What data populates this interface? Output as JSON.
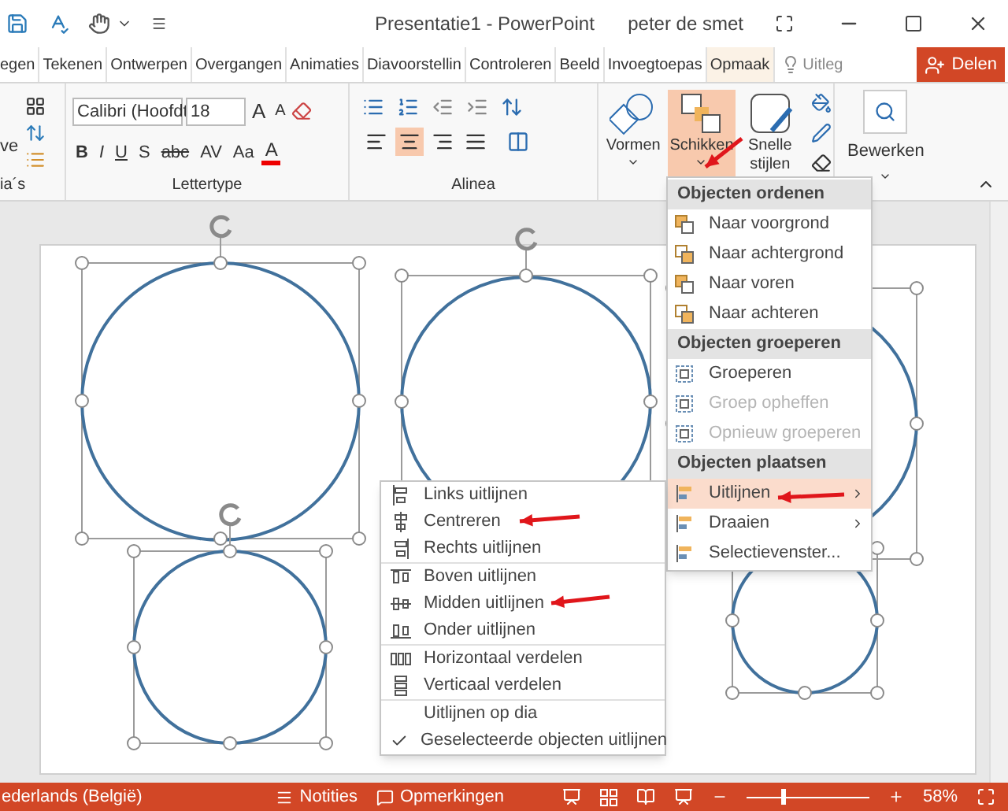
{
  "title_bar": {
    "title": "Presentatie1 - PowerPoint",
    "user": "peter de smet"
  },
  "tabs": [
    {
      "label": "egen",
      "selected": false
    },
    {
      "label": "Tekenen",
      "selected": false
    },
    {
      "label": "Ontwerpen",
      "selected": false
    },
    {
      "label": "Overgangen",
      "selected": false
    },
    {
      "label": "Animaties",
      "selected": false
    },
    {
      "label": "Diavoorstellin",
      "selected": false
    },
    {
      "label": "Controleren",
      "selected": false
    },
    {
      "label": "Beeld",
      "selected": false
    },
    {
      "label": "Invoegtoepas",
      "selected": false
    },
    {
      "label": "Opmaak",
      "selected": true
    }
  ],
  "tell_me": {
    "label": "Uitleg"
  },
  "share_button": {
    "label": "Delen"
  },
  "ribbon": {
    "slides_group": {
      "button_label": "ve",
      "label": "ia´s"
    },
    "font_group": {
      "label": "Lettertype",
      "font_name": "Calibri (Hoofdt",
      "font_size": "18",
      "grow": "A",
      "shrink": "A",
      "format_buttons": [
        "B",
        "I",
        "U",
        "S",
        "abc",
        "AV",
        "Aa"
      ],
      "font_color": "A"
    },
    "paragraph_group": {
      "label": "Alinea",
      "alignments": [
        {
          "selected": false
        },
        {
          "selected": true
        },
        {
          "selected": false
        },
        {
          "selected": false
        }
      ]
    },
    "drawing_group": {
      "buttons": [
        {
          "label": "Vormen",
          "selected": false
        },
        {
          "label": "Schikken",
          "selected": true
        },
        {
          "label": "Snelle stijlen",
          "selected": false
        }
      ]
    },
    "editing_group": {
      "button": "Bewerken"
    }
  },
  "arrange_menu": {
    "sections": [
      {
        "header": "Objecten ordenen",
        "items": [
          {
            "label": "Naar voorgrond",
            "disabled": false,
            "highlighted": false,
            "submenu": false
          },
          {
            "label": "Naar achtergrond",
            "disabled": false,
            "highlighted": false,
            "submenu": false
          },
          {
            "label": "Naar voren",
            "disabled": false,
            "highlighted": false,
            "submenu": false
          },
          {
            "label": "Naar achteren",
            "disabled": false,
            "highlighted": false,
            "submenu": false
          }
        ]
      },
      {
        "header": "Objecten groeperen",
        "items": [
          {
            "label": "Groeperen",
            "disabled": false,
            "highlighted": false,
            "submenu": false
          },
          {
            "label": "Groep opheffen",
            "disabled": true,
            "highlighted": false,
            "submenu": false
          },
          {
            "label": "Opnieuw groeperen",
            "disabled": true,
            "highlighted": false,
            "submenu": false
          }
        ]
      },
      {
        "header": "Objecten plaatsen",
        "items": [
          {
            "label": "Uitlijnen",
            "disabled": false,
            "highlighted": true,
            "submenu": true
          },
          {
            "label": "Draaien",
            "disabled": false,
            "highlighted": false,
            "submenu": true
          },
          {
            "label": "Selectievenster...",
            "disabled": false,
            "highlighted": false,
            "submenu": false
          }
        ]
      }
    ]
  },
  "align_submenu": {
    "groups": [
      {
        "items": [
          {
            "label": "Links uitlijnen"
          },
          {
            "label": "Centreren"
          },
          {
            "label": "Rechts uitlijnen"
          }
        ]
      },
      {
        "items": [
          {
            "label": "Boven uitlijnen"
          },
          {
            "label": "Midden uitlijnen"
          },
          {
            "label": "Onder uitlijnen"
          }
        ]
      },
      {
        "items": [
          {
            "label": "Horizontaal verdelen"
          },
          {
            "label": "Verticaal verdelen"
          }
        ]
      },
      {
        "items": [
          {
            "label": "Uitlijnen op dia",
            "checked": false
          },
          {
            "label": "Geselecteerde objecten uitlijnen",
            "checked": true
          }
        ]
      }
    ]
  },
  "status_bar": {
    "language": "ederlands (België)",
    "notes": "Notities",
    "comments": "Opmerkingen",
    "zoom": {
      "level": 0.28,
      "reading": "58%"
    }
  }
}
